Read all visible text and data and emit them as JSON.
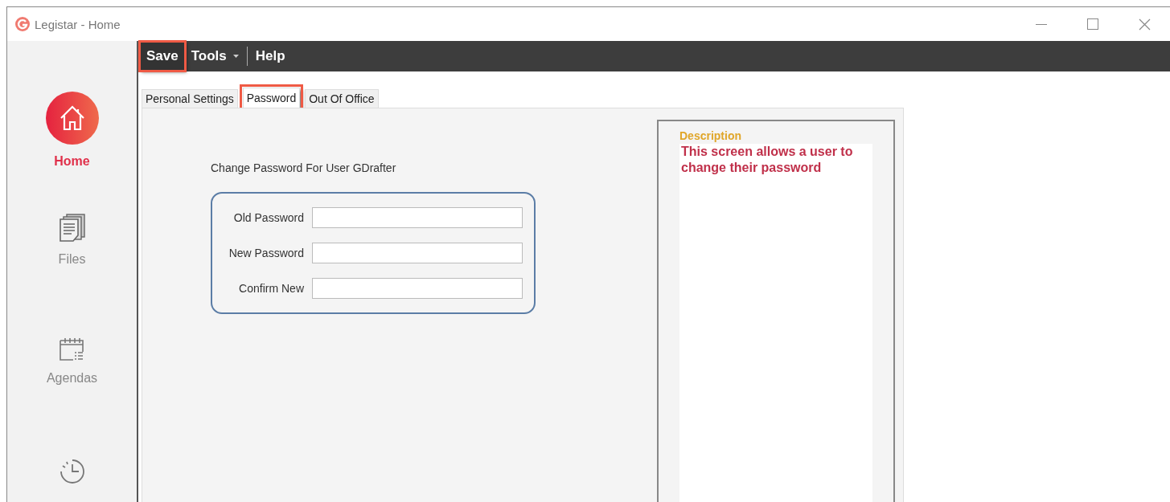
{
  "window": {
    "title": "Legistar - Home"
  },
  "sidebar": {
    "items": [
      {
        "kind": "home",
        "label": "Home",
        "selected": true
      },
      {
        "kind": "files",
        "label": "Files",
        "selected": false
      },
      {
        "kind": "agendas",
        "label": "Agendas",
        "selected": false
      },
      {
        "kind": "clock",
        "selected": false
      }
    ]
  },
  "toolbar": {
    "items": [
      {
        "label": "Save",
        "highlighted": true,
        "dropdown": false
      },
      {
        "label": "Tools",
        "highlighted": false,
        "dropdown": true
      },
      {
        "label": "Help",
        "highlighted": false,
        "dropdown": false
      }
    ]
  },
  "tabs": [
    {
      "label": "Personal Settings",
      "selected": false,
      "highlighted": false
    },
    {
      "label": "Password",
      "selected": true,
      "highlighted": true
    },
    {
      "label": "Out Of Office",
      "selected": false,
      "highlighted": false
    }
  ],
  "form": {
    "heading": "Change Password For User GDrafter",
    "fields": [
      {
        "label": "Old Password"
      },
      {
        "label": "New Password"
      },
      {
        "label": "Confirm New"
      }
    ]
  },
  "description": {
    "title": "Description",
    "text": "This screen allows a user to change their password"
  }
}
